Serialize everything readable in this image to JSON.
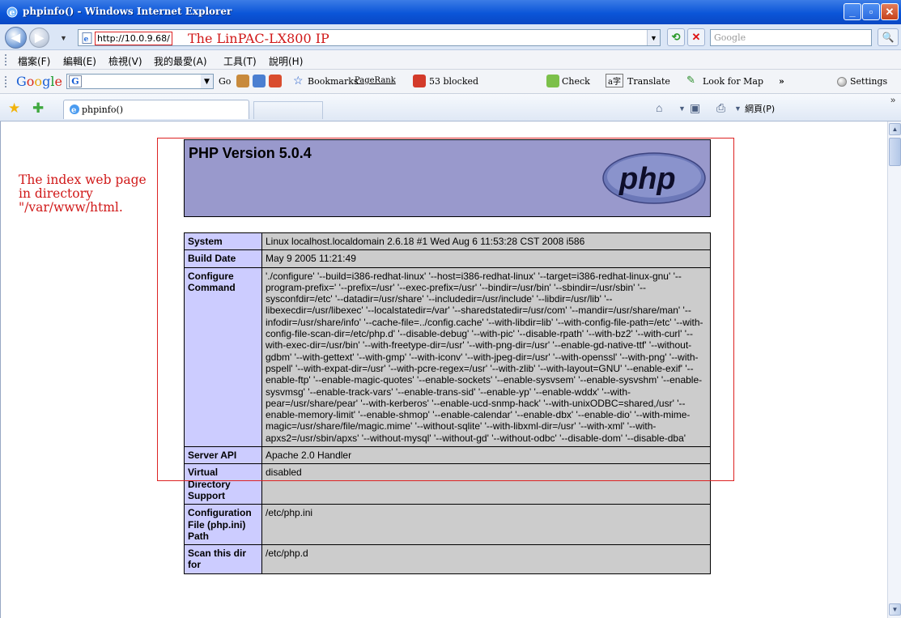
{
  "window": {
    "title": "phpinfo() - Windows Internet Explorer",
    "colors": {
      "titlebar": "#0b55d8",
      "annotation": "#d01818"
    }
  },
  "address_bar": {
    "url": "http://10.0.9.68/",
    "annotation": "The LinPAC-LX800 IP",
    "search_placeholder": "Google"
  },
  "menu": {
    "items": [
      "檔案(F)",
      "編輯(E)",
      "檢視(V)",
      "我的最愛(A)",
      "工具(T)",
      "說明(H)"
    ]
  },
  "google_toolbar": {
    "logo": "Google",
    "go_label": "Go",
    "bookmarks_label": "Bookmarks",
    "pagerank_label": "PageRank",
    "blocked_label": "53 blocked",
    "check_label": "Check",
    "translate_label": "Translate",
    "lookup_label": "Look for Map",
    "more_label": "»",
    "settings_label": "Settings"
  },
  "tab_bar": {
    "tab_title": "phpinfo()",
    "page_menu": "網頁(P)",
    "more_label": "»"
  },
  "page": {
    "side_note": "The index web page in directory \"/var/www/html.",
    "php_version": "PHP Version 5.0.4",
    "php_logo_text": "php",
    "rows": [
      {
        "key": "System",
        "value": "Linux localhost.localdomain 2.6.18 #1 Wed Aug 6 11:53:28 CST 2008 i586"
      },
      {
        "key": "Build Date",
        "value": "May 9 2005 11:21:49"
      },
      {
        "key": "Configure Command",
        "value": "'./configure' '--build=i386-redhat-linux' '--host=i386-redhat-linux' '--target=i386-redhat-linux-gnu' '--program-prefix=' '--prefix=/usr' '--exec-prefix=/usr' '--bindir=/usr/bin' '--sbindir=/usr/sbin' '--sysconfdir=/etc' '--datadir=/usr/share' '--includedir=/usr/include' '--libdir=/usr/lib' '--libexecdir=/usr/libexec' '--localstatedir=/var' '--sharedstatedir=/usr/com' '--mandir=/usr/share/man' '--infodir=/usr/share/info' '--cache-file=../config.cache' '--with-libdir=lib' '--with-config-file-path=/etc' '--with-config-file-scan-dir=/etc/php.d' '--disable-debug' '--with-pic' '--disable-rpath' '--with-bz2' '--with-curl' '--with-exec-dir=/usr/bin' '--with-freetype-dir=/usr' '--with-png-dir=/usr' '--enable-gd-native-ttf' '--without-gdbm' '--with-gettext' '--with-gmp' '--with-iconv' '--with-jpeg-dir=/usr' '--with-openssl' '--with-png' '--with-pspell' '--with-expat-dir=/usr' '--with-pcre-regex=/usr' '--with-zlib' '--with-layout=GNU' '--enable-exif' '--enable-ftp' '--enable-magic-quotes' '--enable-sockets' '--enable-sysvsem' '--enable-sysvshm' '--enable-sysvmsg' '--enable-track-vars' '--enable-trans-sid' '--enable-yp' '--enable-wddx' '--with-pear=/usr/share/pear' '--with-kerberos' '--enable-ucd-snmp-hack' '--with-unixODBC=shared,/usr' '--enable-memory-limit' '--enable-shmop' '--enable-calendar' '--enable-dbx' '--enable-dio' '--with-mime-magic=/usr/share/file/magic.mime' '--without-sqlite' '--with-libxml-dir=/usr' '--with-xml' '--with-apxs2=/usr/sbin/apxs' '--without-mysql' '--without-gd' '--without-odbc' '--disable-dom' '--disable-dba'"
      },
      {
        "key": "Server API",
        "value": "Apache 2.0 Handler"
      },
      {
        "key": "Virtual Directory Support",
        "value": "disabled"
      },
      {
        "key": "Configuration File (php.ini) Path",
        "value": "/etc/php.ini"
      },
      {
        "key": "Scan this dir for",
        "value": "/etc/php.d"
      }
    ]
  }
}
